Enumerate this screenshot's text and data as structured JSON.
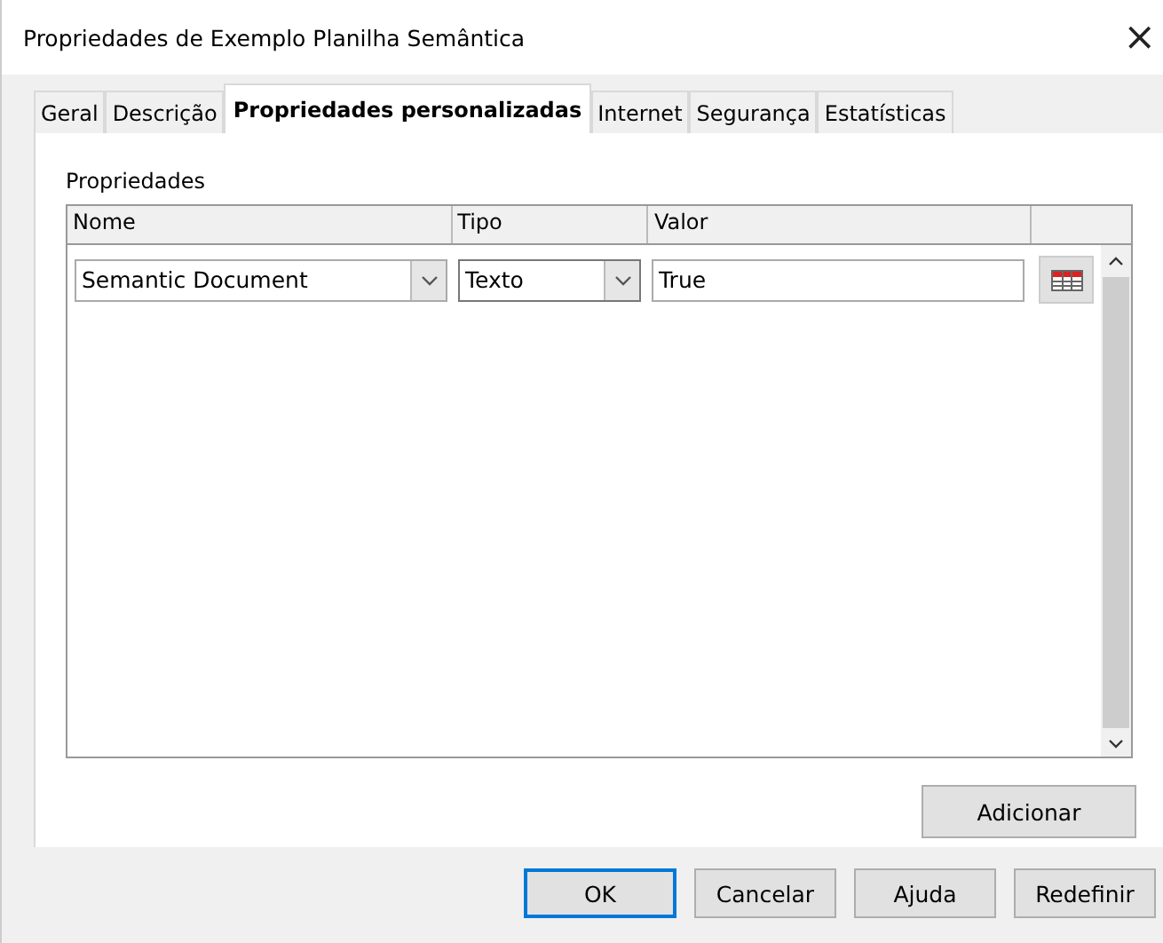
{
  "window": {
    "title": "Propriedades de Exemplo Planilha Semântica",
    "close": "×"
  },
  "tabs": [
    {
      "label": "Geral",
      "selected": false
    },
    {
      "label": "Descrição",
      "selected": false
    },
    {
      "label": "Propriedades personalizadas",
      "selected": true
    },
    {
      "label": "Internet",
      "selected": false
    },
    {
      "label": "Segurança",
      "selected": false
    },
    {
      "label": "Estatísticas",
      "selected": false
    }
  ],
  "section_label": "Propriedades",
  "table": {
    "columns": [
      "Nome",
      "Tipo",
      "Valor"
    ],
    "rows": [
      {
        "name": "Semantic Document",
        "type": "Texto",
        "value": "True"
      }
    ]
  },
  "add_button": "Adicionar",
  "buttons": [
    {
      "label": "OK",
      "default": true
    },
    {
      "label": "Cancelar",
      "default": false
    },
    {
      "label": "Ajuda",
      "default": false
    },
    {
      "label": "Redefinir",
      "default": false
    }
  ]
}
